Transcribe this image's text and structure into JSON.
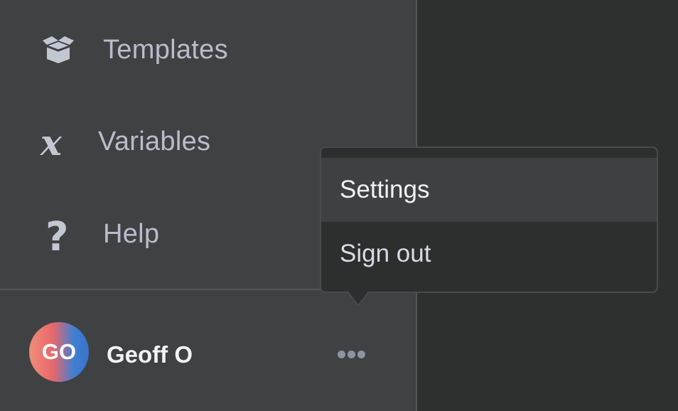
{
  "sidebar": {
    "items": [
      {
        "label": "Templates",
        "icon": "box-icon"
      },
      {
        "label": "Variables",
        "icon": "variable-x-icon"
      },
      {
        "label": "Help",
        "icon": "question-icon"
      }
    ],
    "user": {
      "initials": "GO",
      "name": "Geoff O",
      "more_icon": "ellipsis-icon"
    }
  },
  "menu": {
    "items": [
      {
        "label": "Settings"
      },
      {
        "label": "Sign out"
      }
    ]
  },
  "colors": {
    "sidebar_bg": "#404143",
    "main_bg": "#2e2f2f",
    "menu_bg": "#2d2e2e",
    "menu_hover_bg": "#3f4042",
    "nav_text": "#b9bdca",
    "icon": "#c3c7d2"
  }
}
